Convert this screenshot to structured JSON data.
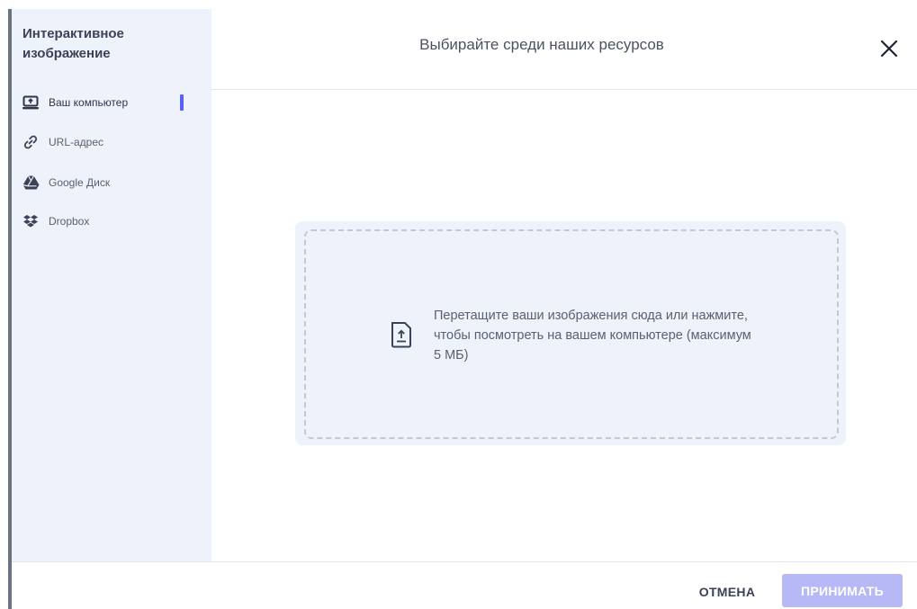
{
  "sidebar": {
    "title": "Интерактивное изображение",
    "items": [
      {
        "label": "Ваш компьютер",
        "icon": "laptop-upload-icon",
        "active": true
      },
      {
        "label": "URL-адрес",
        "icon": "link-icon",
        "active": false
      },
      {
        "label": "Google Диск",
        "icon": "google-drive-icon",
        "active": false
      },
      {
        "label": "Dropbox",
        "icon": "dropbox-icon",
        "active": false
      }
    ]
  },
  "header": {
    "title": "Выбирайте среди наших ресурсов",
    "close_icon": "close-icon"
  },
  "dropzone": {
    "text": "Перетащите ваши изображения сюда или нажмите, чтобы посмотреть на вашем компьютере (максимум 5 МБ)",
    "icon": "file-upload-icon"
  },
  "footer": {
    "cancel_label": "ОТМЕНА",
    "accept_label": "ПРИНИМАТЬ"
  },
  "colors": {
    "accent": "#5c5ff5",
    "accept_disabled": "#b7b9f7",
    "sidebar_bg": "#eef2fb"
  }
}
